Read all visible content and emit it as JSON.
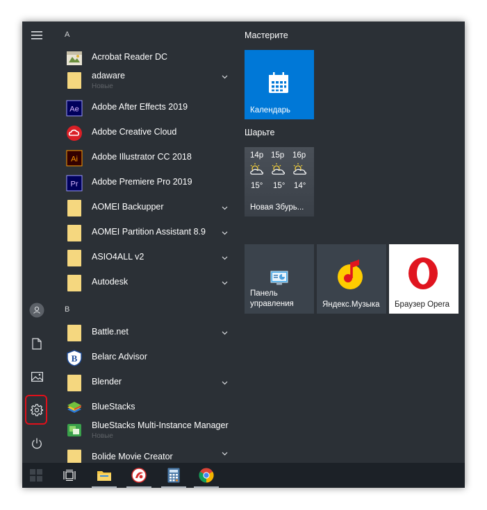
{
  "start_menu": {
    "rail": {
      "items": [
        "menu-icon",
        "account-icon",
        "documents-icon",
        "pictures-icon",
        "settings-icon",
        "power-icon"
      ],
      "highlight_color": "#e0101a"
    },
    "app_list": {
      "sections": [
        {
          "letter": "A",
          "apps": [
            {
              "label": "Acrobat Reader DC",
              "icon": "acrobat-reader-icon"
            },
            {
              "label": "adaware",
              "sub": "Новые",
              "icon": "folder-icon",
              "expandable": true
            },
            {
              "label": "Adobe After Effects 2019",
              "icon": "after-effects-icon"
            },
            {
              "label": "Adobe Creative Cloud",
              "icon": "creative-cloud-icon"
            },
            {
              "label": "Adobe Illustrator CC 2018",
              "icon": "illustrator-icon"
            },
            {
              "label": "Adobe Premiere Pro 2019",
              "icon": "premiere-pro-icon"
            },
            {
              "label": "AOMEI Backupper",
              "icon": "folder-icon",
              "expandable": true
            },
            {
              "label": "AOMEI Partition Assistant 8.9",
              "icon": "folder-icon",
              "expandable": true
            },
            {
              "label": "ASIO4ALL v2",
              "icon": "folder-icon",
              "expandable": true
            },
            {
              "label": "Autodesk",
              "icon": "folder-icon",
              "expandable": true
            }
          ]
        },
        {
          "letter": "B",
          "apps": [
            {
              "label": "Battle.net",
              "icon": "folder-icon",
              "expandable": true
            },
            {
              "label": "Belarc Advisor",
              "icon": "belarc-icon"
            },
            {
              "label": "Blender",
              "icon": "folder-icon",
              "expandable": true
            },
            {
              "label": "BlueStacks",
              "icon": "bluestacks-icon"
            },
            {
              "label": "BlueStacks Multi-Instance Manager",
              "sub": "Новые",
              "icon": "bluestacks-mim-icon"
            },
            {
              "label": "Bolide Movie Creator",
              "icon": "folder-icon",
              "expandable": true
            }
          ]
        }
      ]
    },
    "tiles": {
      "group1_title": "Мастерите",
      "calendar_label": "Календарь",
      "group2_title": "Шарьте",
      "weather": {
        "days": [
          {
            "time": "14р",
            "temp": "15°"
          },
          {
            "time": "15р",
            "temp": "15°"
          },
          {
            "time": "16р",
            "temp": "14°"
          }
        ],
        "location": "Новая Збурь..."
      },
      "control_panel_label": "Панель управления",
      "yandex_music_label": "Яндекс.Музыка",
      "opera_label": "Браузер Opera"
    },
    "colors": {
      "accent": "#0078d7",
      "menu_bg": "#2b3036",
      "tile_bg": "#3b434c",
      "taskbar_bg": "#1c2127",
      "opera_red": "#e0151f",
      "yandex_yellow": "#ffcc00"
    }
  },
  "taskbar": {
    "items": [
      "start-icon",
      "task-view-icon",
      "file-explorer-icon",
      "app-icon",
      "calculator-icon",
      "chrome-icon"
    ]
  }
}
